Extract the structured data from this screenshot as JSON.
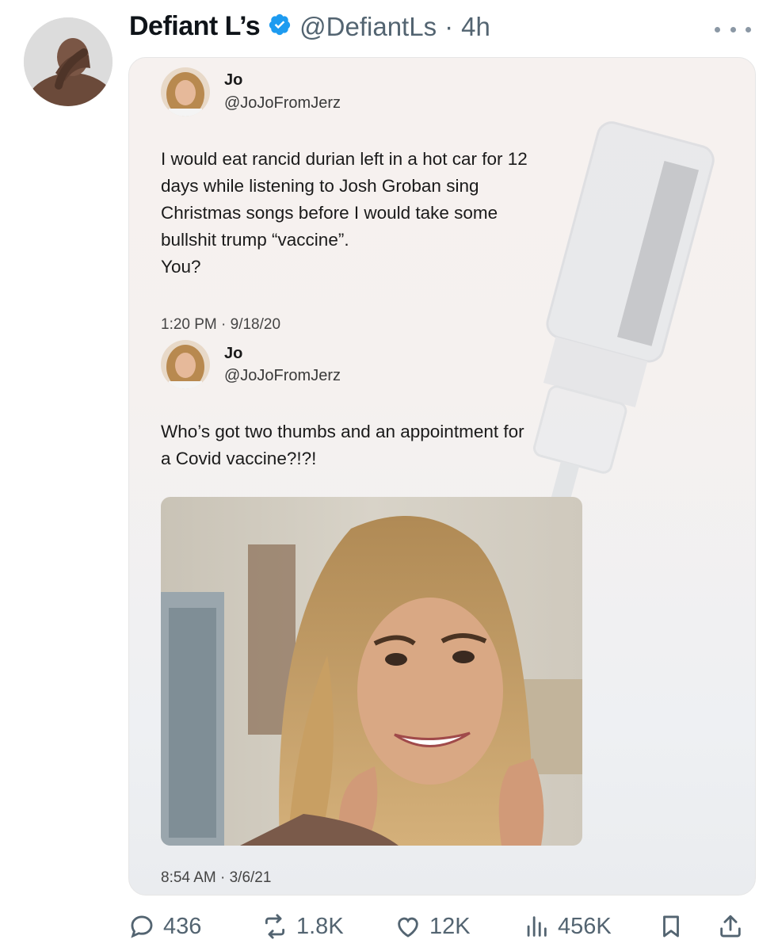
{
  "author": {
    "display_name": "Defiant L’s",
    "handle": "@DefiantLs",
    "separator": "·",
    "age": "4h",
    "verified_icon": "verified-badge-icon"
  },
  "quote_1": {
    "name": "Jo",
    "handle": "@JoJoFromJerz",
    "lines": [
      "I would eat rancid durian left in a hot car for 12",
      "days while listening to Josh Groban sing",
      "Christmas songs before I would take some",
      "bullshit trump “vaccine”.",
      "You?"
    ],
    "timestamp": "1:20 PM · 9/18/20"
  },
  "quote_2": {
    "name": "Jo",
    "handle": "@JoJoFromJerz",
    "lines": [
      "Who’s got two thumbs and an appointment for",
      "a Covid vaccine?!?!"
    ],
    "timestamp": "8:54 AM · 3/6/21"
  },
  "actions": {
    "replies": "436",
    "reposts": "1.8K",
    "likes": "12K",
    "views": "456K"
  },
  "colors": {
    "text": "#0f1419",
    "muted": "#536471",
    "verified": "#1d9bf0"
  }
}
